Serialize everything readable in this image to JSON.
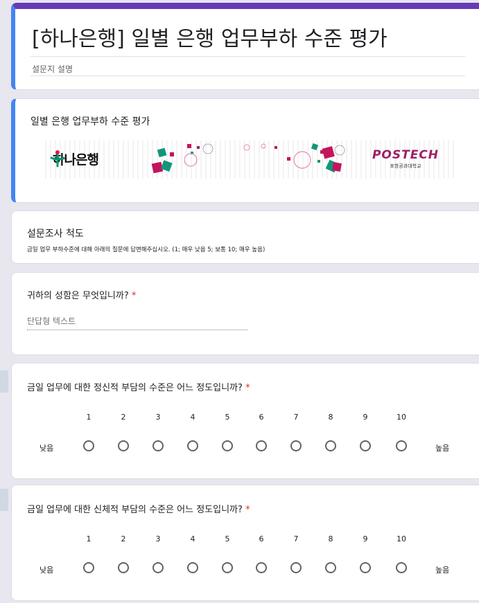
{
  "form": {
    "title": "[하나은행] 일별 은행 업무부하 수준 평가",
    "description": "설문지 설명",
    "theme_color": "#673ab7",
    "accent_color": "#4285f4"
  },
  "section": {
    "title": "일별 은행 업무부하 수준 평가",
    "banner": {
      "left_logo": "하나은행",
      "right_logo": "POSTECH",
      "right_logo_sub": "포항공과대학교"
    }
  },
  "scale_info": {
    "title": "설문조사 척도",
    "description": "금일 업무 부하수준에 대해 아래의 질문에 답변해주십시오. (1; 매우 낮음 5; 보통 10; 매우 높음)"
  },
  "questions": {
    "name": {
      "title": "귀하의 성함은 무엇입니까?",
      "required_mark": "*",
      "placeholder": "단답형 텍스트"
    },
    "mental": {
      "title": "금일 업무에 대한 정신적 부담의 수준은 어느 정도입니까?",
      "required_mark": "*",
      "scale": [
        "1",
        "2",
        "3",
        "4",
        "5",
        "6",
        "7",
        "8",
        "9",
        "10"
      ],
      "low_label": "낮음",
      "high_label": "높음"
    },
    "physical": {
      "title": "금일 업무에 대한 신체적 부담의 수준은 어느 정도입니까?",
      "required_mark": "*",
      "scale": [
        "1",
        "2",
        "3",
        "4",
        "5",
        "6",
        "7",
        "8",
        "9",
        "10"
      ],
      "low_label": "낮음",
      "high_label": "높음"
    }
  }
}
